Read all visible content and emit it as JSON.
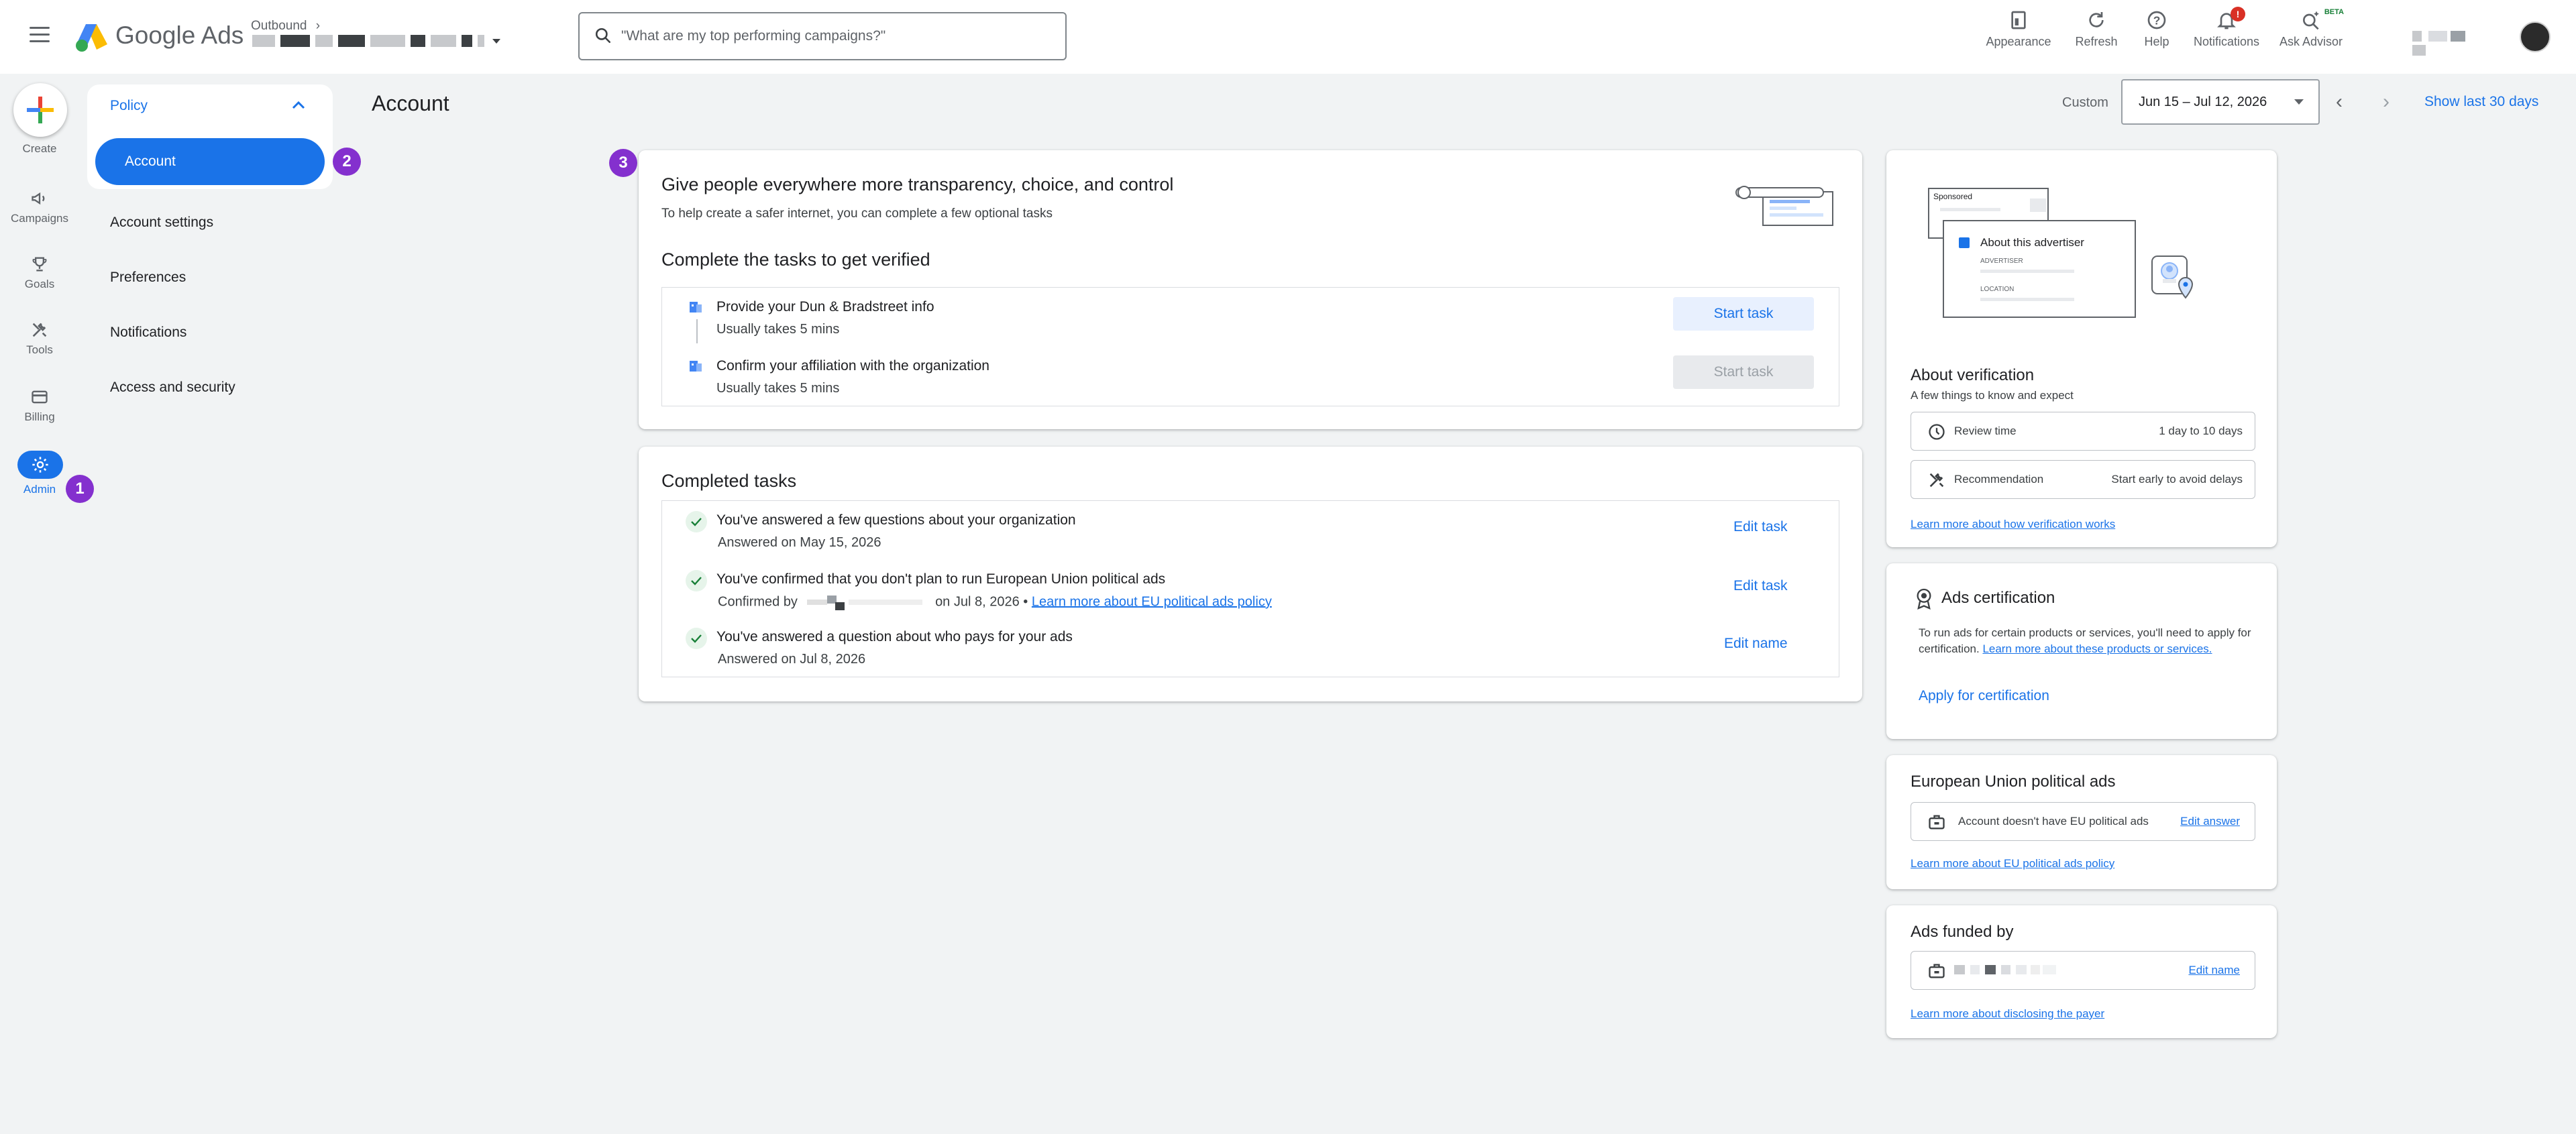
{
  "topbar": {
    "product_name": "Google Ads",
    "breadcrumb_parent": "Outbound",
    "search_placeholder": "\"What are my top performing campaigns?\"",
    "appearance": "Appearance",
    "refresh": "Refresh",
    "help": "Help",
    "notifications": "Notifications",
    "notifications_count": "!",
    "ask_advisor": "Ask Advisor",
    "beta": "BETA"
  },
  "nav": {
    "create": "Create",
    "campaigns": "Campaigns",
    "goals": "Goals",
    "tools": "Tools",
    "billing": "Billing",
    "admin": "Admin"
  },
  "badges": {
    "b1": "1",
    "b2": "2",
    "b3": "3"
  },
  "subnav": {
    "section": "Policy",
    "active": "Account",
    "items": [
      "Account settings",
      "Preferences",
      "Notifications",
      "Access and security"
    ]
  },
  "page": {
    "title": "Account"
  },
  "date": {
    "custom": "Custom",
    "range": "Jun 15 – Jul 12, 2026",
    "show_last": "Show last 30 days"
  },
  "verify": {
    "heading": "Give people everywhere more transparency, choice, and control",
    "subheading": "To help create a safer internet, you can complete a few optional tasks",
    "tasks_heading": "Complete the tasks to get verified",
    "tasks": [
      {
        "title": "Provide your Dun & Bradstreet info",
        "note": "Usually takes 5 mins",
        "button": "Start task"
      },
      {
        "title": "Confirm your affiliation with the organization",
        "note": "Usually takes 5 mins",
        "button": "Start task"
      }
    ]
  },
  "completed": {
    "heading": "Completed tasks",
    "items": [
      {
        "title": "You've answered a few questions about your organization",
        "note": "Answered on May 15, 2026",
        "action": "Edit task"
      },
      {
        "title": "You've confirmed that you don't plan to run European Union political ads",
        "note_prefix": "Confirmed by",
        "note_suffix": "on Jul 8, 2026 •",
        "note_link": "Learn more about EU political ads policy",
        "action": "Edit task"
      },
      {
        "title": "You've answered a question about who pays for your ads",
        "note": "Answered on Jul 8, 2026",
        "action": "Edit name"
      }
    ]
  },
  "about": {
    "illus_sponsored": "Sponsored",
    "illus_about": "About this advertiser",
    "illus_advertiser": "ADVERTISER",
    "illus_location": "LOCATION",
    "title": "About verification",
    "subtitle": "A few things to know and expect",
    "rows": [
      {
        "label": "Review time",
        "value": "1 day to 10 days"
      },
      {
        "label": "Recommendation",
        "value": "Start early to avoid delays"
      }
    ],
    "link": "Learn more about how verification works"
  },
  "cert": {
    "title": "Ads certification",
    "body": "To run ads for certain products or services, you'll need to apply for certification.",
    "body_link": "Learn more about these products or services.",
    "action": "Apply for certification"
  },
  "eu": {
    "title": "European Union political ads",
    "status": "Account doesn't have EU political ads",
    "action": "Edit answer",
    "link": "Learn more about EU political ads policy"
  },
  "funded": {
    "title": "Ads funded by",
    "action": "Edit name",
    "link": "Learn more about disclosing the payer"
  },
  "colors": {
    "accent": "#1a73e8",
    "badge": "#8430ce",
    "alert": "#d93025",
    "success": "#188038"
  }
}
